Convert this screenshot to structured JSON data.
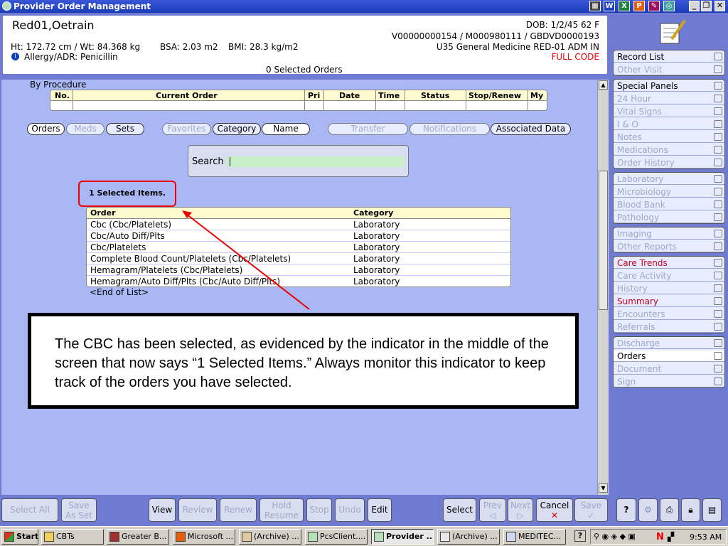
{
  "window": {
    "title": "Provider Order Management"
  },
  "patient": {
    "name": "Red01,Oetrain",
    "dob": "DOB: 1/2/45 62 F",
    "ids": "V00000000154 / M000980111 / GBDVD0000193",
    "location": "U35 General Medicine RED-01  ADM IN",
    "code_status": "FULL CODE",
    "ht_wt": "Ht: 172.72 cm / Wt: 84.368 kg",
    "bsa": "BSA: 2.03 m2",
    "bmi": "BMI: 28.3 kg/m2",
    "allergy": "Allergy/ADR: Penicillin",
    "selected_orders": "0 Selected Orders"
  },
  "current_orders": {
    "group_label": "By Procedure",
    "columns": [
      "No.",
      "Current Order",
      "Pri",
      "Date",
      "Time",
      "Status",
      "Stop/Renew",
      "My"
    ]
  },
  "tabs": [
    "Orders",
    "Meds",
    "Sets",
    "Favorites",
    "Category",
    "Name",
    "Transfer",
    "Notifications",
    "Associated Data"
  ],
  "search": {
    "label": "Search",
    "value": ""
  },
  "selected_indicator": "1 Selected Items.",
  "results": {
    "columns": [
      "Order",
      "Category"
    ],
    "rows": [
      {
        "order": "Cbc (Cbc/Platelets)",
        "category": "Laboratory"
      },
      {
        "order": "Cbc/Auto Diff/Plts",
        "category": "Laboratory"
      },
      {
        "order": "Cbc/Platelets",
        "category": "Laboratory"
      },
      {
        "order": "Complete Blood Count/Platelets (Cbc/Platelets)",
        "category": "Laboratory"
      },
      {
        "order": "Hemagram/Platelets (Cbc/Platelets)",
        "category": "Laboratory"
      },
      {
        "order": "Hemagram/Auto Diff/Plts (Cbc/Auto Diff/Plts)",
        "category": "Laboratory"
      }
    ],
    "end_label": "<End of List>"
  },
  "callout": "The CBC has been selected, as evidenced by the indicator in the middle of the screen that now says “1 Selected Items.”  Always monitor this indicator to keep track of the orders you have selected.",
  "right_panel": {
    "group1": [
      "Record List",
      "Other Visit"
    ],
    "group2": [
      "Special Panels",
      "24 Hour",
      "Vital Signs",
      "I & O",
      "Notes",
      "Medications",
      "Order History"
    ],
    "group3": [
      "Laboratory",
      "Microbiology",
      "Blood Bank",
      "Pathology"
    ],
    "group4": [
      "Imaging",
      "Other Reports"
    ],
    "group5": [
      "Care Trends",
      "Care Activity",
      "History",
      "Summary",
      "Encounters",
      "Referrals"
    ],
    "group6": [
      "Discharge",
      "Orders",
      "Document",
      "Sign"
    ]
  },
  "bottom_buttons": {
    "select_all": "Select All",
    "save_as_set_1": "Save",
    "save_as_set_2": "As Set",
    "view": "View",
    "review": "Review",
    "renew": "Renew",
    "hold_1": "Hold",
    "hold_2": "Resume",
    "stop": "Stop",
    "undo": "Undo",
    "edit": "Edit",
    "select": "Select",
    "prev": "Prev",
    "next": "Next",
    "cancel": "Cancel",
    "save": "Save",
    "help": "?"
  },
  "taskbar": {
    "start": "Start",
    "items": [
      "CBTs",
      "Greater B...",
      "Microsoft ...",
      "(Archive) ...",
      "PcsClient....",
      "Provider ...",
      "(Archive) ...",
      "MEDITEC..."
    ],
    "clock": "9:53 AM"
  },
  "colors": {
    "accent": "#6e7bd0",
    "highlight_red": "#e00000",
    "panel_bg": "#a9b7f5"
  }
}
